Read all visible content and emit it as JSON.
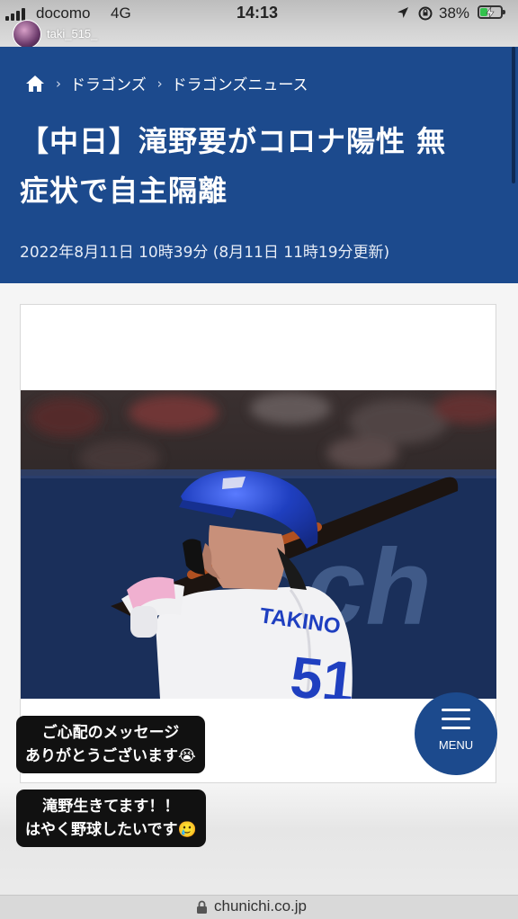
{
  "status_bar": {
    "carrier": "docomo",
    "network": "4G",
    "time": "14:13",
    "battery_percent": "38%",
    "battery_level": 0.38,
    "icons": [
      "signal-icon",
      "location-arrow-icon",
      "rotation-lock-icon",
      "battery-charging-icon"
    ]
  },
  "story": {
    "username": "taki_515_",
    "sticker1": {
      "line1": "ご心配のメッセージ",
      "line2": "ありがとうございます😭"
    },
    "sticker2": {
      "line1": "滝野生きてます！！",
      "line2": "はやく野球したいです🥲"
    }
  },
  "breadcrumb": {
    "home_icon": "home-icon",
    "items": [
      "ドラゴンズ",
      "ドラゴンズニュース"
    ]
  },
  "article": {
    "headline_line1": "【中日】滝野要がコロナ陽性 無",
    "headline_line2": "症状で自主隔離",
    "dateline": "2022年8月11日 10時39分 (8月11日 11時19分更新)",
    "photo_jersey_text": "TAKINO",
    "photo_jersey_number": "51",
    "photo_banner_text": "sch"
  },
  "menu": {
    "label": "MENU",
    "icon": "hamburger-icon"
  },
  "url_bar": {
    "domain": "chunichi.co.jp",
    "icon": "lock-icon"
  },
  "colors": {
    "header_blue": "#1c4a8d",
    "helmet_blue": "#1f3fc0",
    "battery_green": "#33c24d"
  }
}
